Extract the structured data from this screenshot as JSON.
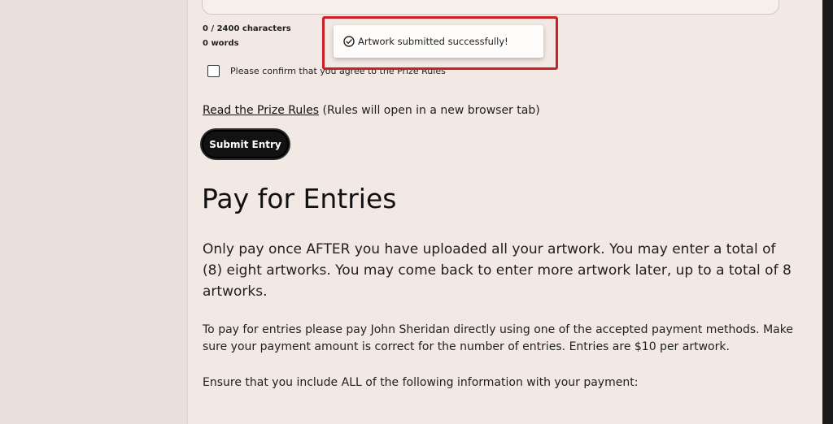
{
  "form": {
    "char_count": "0 / 2400 characters",
    "word_count": "0 words",
    "confirm_label": "Please confirm that you agree to the Prize Rules",
    "rules_link": "Read the Prize Rules",
    "rules_note": " (Rules will open in a new browser tab)",
    "submit_label": "Submit Entry"
  },
  "toast": {
    "message": "Artwork submitted successfully!",
    "icon": "check-circle-icon",
    "highlight_color": "#cc1f26"
  },
  "payment": {
    "heading": "Pay for Entries",
    "intro": "Only pay once AFTER you have uploaded all your artwork. You may enter a total of (8) eight artworks. You may come back to enter more artwork later, up to a total of 8 artworks.",
    "instructions": "To pay for entries please pay John Sheridan directly using one of the accepted payment methods. Make sure your payment amount is correct for the number of entries. Entries are $10 per artwork.",
    "include_note": "Ensure that you include ALL of the following information with your payment:"
  }
}
